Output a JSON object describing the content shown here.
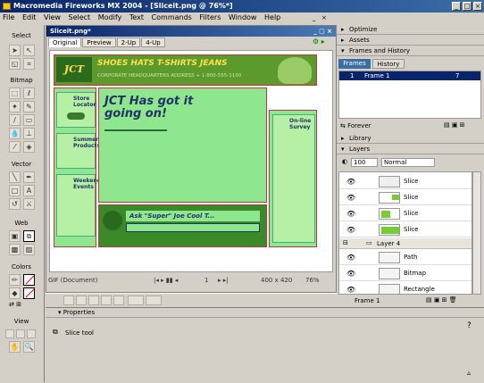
{
  "app": {
    "title": "Macromedia Fireworks MX 2004 - [Sliceit.png @ 76%*]"
  },
  "menu": [
    "File",
    "Edit",
    "View",
    "Select",
    "Modify",
    "Text",
    "Commands",
    "Filters",
    "Window",
    "Help"
  ],
  "tools": {
    "sections": [
      "Select",
      "Bitmap",
      "Vector",
      "Web",
      "Colors",
      "View"
    ]
  },
  "document": {
    "tab": "Sliceit.png*",
    "view_tabs": [
      "Original",
      "Preview",
      "2-Up",
      "4-Up"
    ],
    "status_format": "GIF (Document)",
    "page": "1",
    "size": "400 x 420",
    "zoom": "76%"
  },
  "site": {
    "banner": "SHOES HATS T-SHIRTS JEANS",
    "address": "CORPORATE HEADQUARTERS ADDRESS + 1-800-555-1100",
    "headline": "JCT Has got it going on!",
    "left_boxes": [
      "Store Locator",
      "Summer Products",
      "Weekend Events"
    ],
    "right_box": "On-line Survey",
    "bottom": "Ask \"Super\" Joe Cool T..."
  },
  "panels": {
    "optimize": "Optimize",
    "assets": "Assets",
    "frames_history": "Frames and History",
    "frames_tab": "Frames",
    "history_tab": "History",
    "frame_row": {
      "num": "1",
      "name": "Frame 1",
      "delay": "7"
    },
    "forever": "Forever",
    "library": "Library",
    "layers": "Layers",
    "opacity": "100",
    "blend": "Normal",
    "layer_rows": [
      "Slice",
      "Slice",
      "Slice",
      "Slice",
      "Layer 4",
      "Path",
      "Bitmap",
      "Rectangle"
    ],
    "layers_footer": "Frame 1"
  },
  "properties": {
    "title": "Properties",
    "tool": "Slice tool"
  }
}
